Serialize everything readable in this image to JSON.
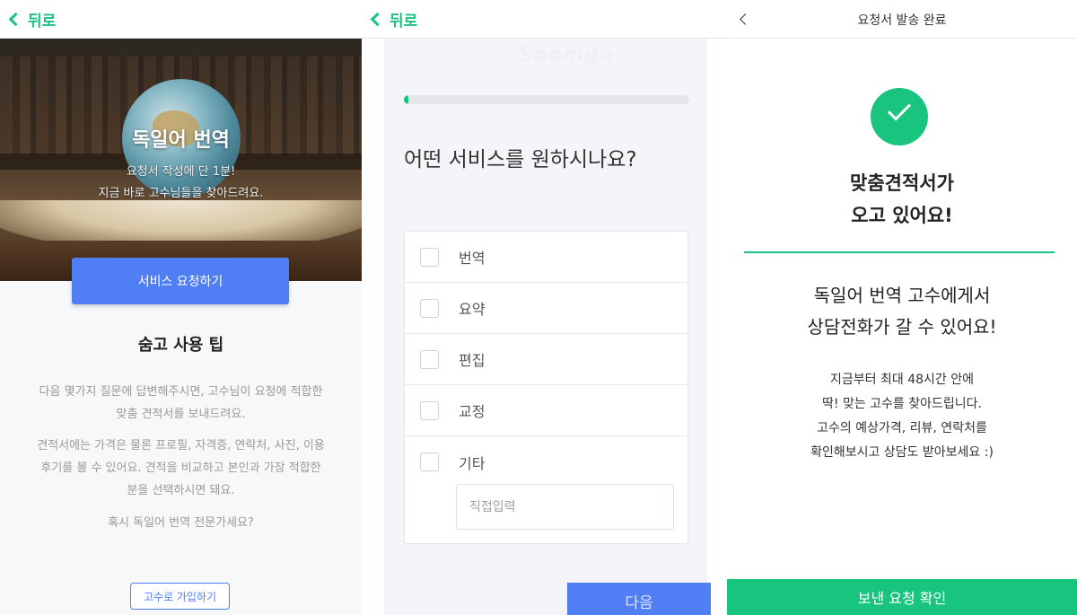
{
  "screen1": {
    "back_label": "뒤로",
    "hero_title": "독일어 번역",
    "hero_subtitle_line1": "요청서 작성에 단 1분!",
    "hero_subtitle_line2": "지금 바로 고수님들을 찾아드려요.",
    "request_button": "서비스 요청하기",
    "tip_title": "숨고 사용 팁",
    "tip_paragraph1_line1": "다음 몇가지 질문에 답변해주시면, 고수님이 요청에 적합한",
    "tip_paragraph1_line2": "맞춤 견적서를 보내드려요.",
    "tip_paragraph2_line1": "견적서에는 가격은 물론 프로필, 자격증, 연락처, 사진, 이용",
    "tip_paragraph2_line2": "후기를 볼 수 있어요. 견적을 비교하고 본인과 가장 적합한",
    "tip_paragraph2_line3": "분을 선택하시면 돼요.",
    "tip_question": "혹시 독일어 번역 전문가세요?",
    "join_button": "고수로 가입하기"
  },
  "screen2": {
    "back_label": "뒤로",
    "watermark": "Soomgo",
    "progress_fraction": 0.01,
    "question": "어떤 서비스를 원하시나요?",
    "options": [
      {
        "label": "번역",
        "checked": false
      },
      {
        "label": "요약",
        "checked": false
      },
      {
        "label": "편집",
        "checked": false
      },
      {
        "label": "교정",
        "checked": false
      },
      {
        "label": "기타",
        "checked": false
      }
    ],
    "direct_input_placeholder": "직접입력",
    "next_button": "다음"
  },
  "screen3": {
    "title": "요청서 발송 완료",
    "headline_line1": "맞춤견적서가",
    "headline_line2": "오고 있어요!",
    "body_line1": "독일어 번역 고수에게서",
    "body_line2": "상담전화가 갈 수 있어요!",
    "detail_line1": "지금부터 최대 48시간 안에",
    "detail_line2": "딱! 맞는 고수를 찾아드립니다.",
    "detail_line3": "고수의 예상가격, 리뷰, 연락처를",
    "detail_line4": "확인해보시고 상담도 받아보세요 :)",
    "confirm_button": "보낸 요청 확인"
  },
  "colors": {
    "accent_green": "#19c47f",
    "accent_blue": "#4f7ef5"
  }
}
